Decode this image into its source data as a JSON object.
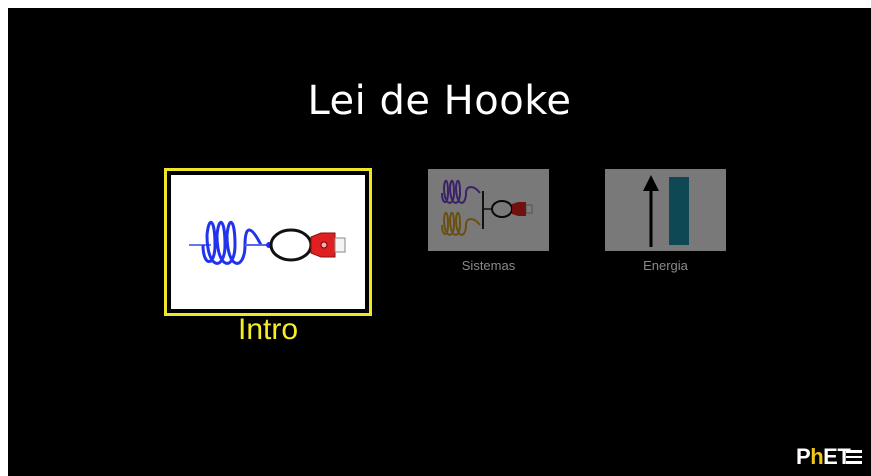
{
  "app": {
    "title": "Lei de Hooke"
  },
  "screens": [
    {
      "label": "Intro",
      "selected": true,
      "icon": "spring-grabber-icon"
    },
    {
      "label": "Sistemas",
      "selected": false,
      "icon": "two-springs-icon"
    },
    {
      "label": "Energia",
      "selected": false,
      "icon": "energy-bar-icon"
    }
  ],
  "footer": {
    "logo_text": "PhET",
    "menu_icon": "hamburger-menu-icon"
  },
  "colors": {
    "background": "#000000",
    "selected_border": "#f0e72a",
    "selected_label": "#f5ec2a",
    "unselected_label": "#8a8a8a",
    "spring_blue": "#2233ee",
    "spring_purple": "#7744cc",
    "spring_orange": "#d4a020",
    "grabber_red": "#e02020",
    "energy_bar": "#1a8fa8"
  }
}
